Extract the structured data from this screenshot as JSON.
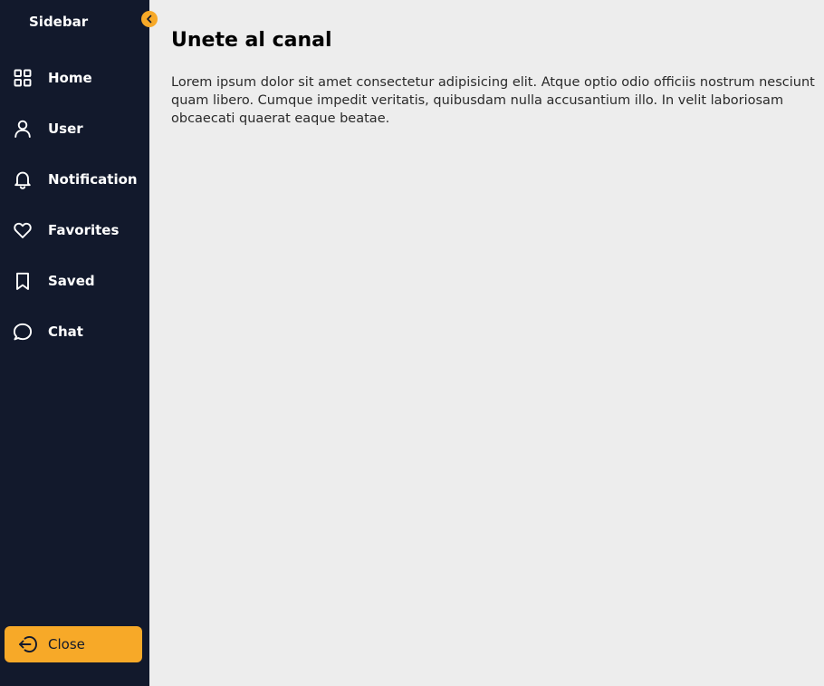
{
  "sidebar": {
    "brand": "Sidebar",
    "items": [
      {
        "label": "Home",
        "icon": "grid-icon"
      },
      {
        "label": "User",
        "icon": "user-icon"
      },
      {
        "label": "Notification",
        "icon": "bell-icon"
      },
      {
        "label": "Favorites",
        "icon": "heart-icon"
      },
      {
        "label": "Saved",
        "icon": "bookmark-icon"
      },
      {
        "label": "Chat",
        "icon": "chat-bubble-icon"
      }
    ],
    "close_label": "Close",
    "close_icon": "logout-icon",
    "toggle_icon": "chevron-left-icon"
  },
  "main": {
    "title": "Unete al canal",
    "text": "Lorem ipsum dolor sit amet consectetur adipisicing elit. Atque optio odio officiis nostrum nesciunt quam libero. Cumque impedit veritatis, quibusdam nulla accusantium illo. In velit laboriosam obcaecati quaerat eaque beatae."
  },
  "colors": {
    "sidebar_bg": "#12192c",
    "accent": "#f7a928",
    "main_bg": "#ededed"
  }
}
